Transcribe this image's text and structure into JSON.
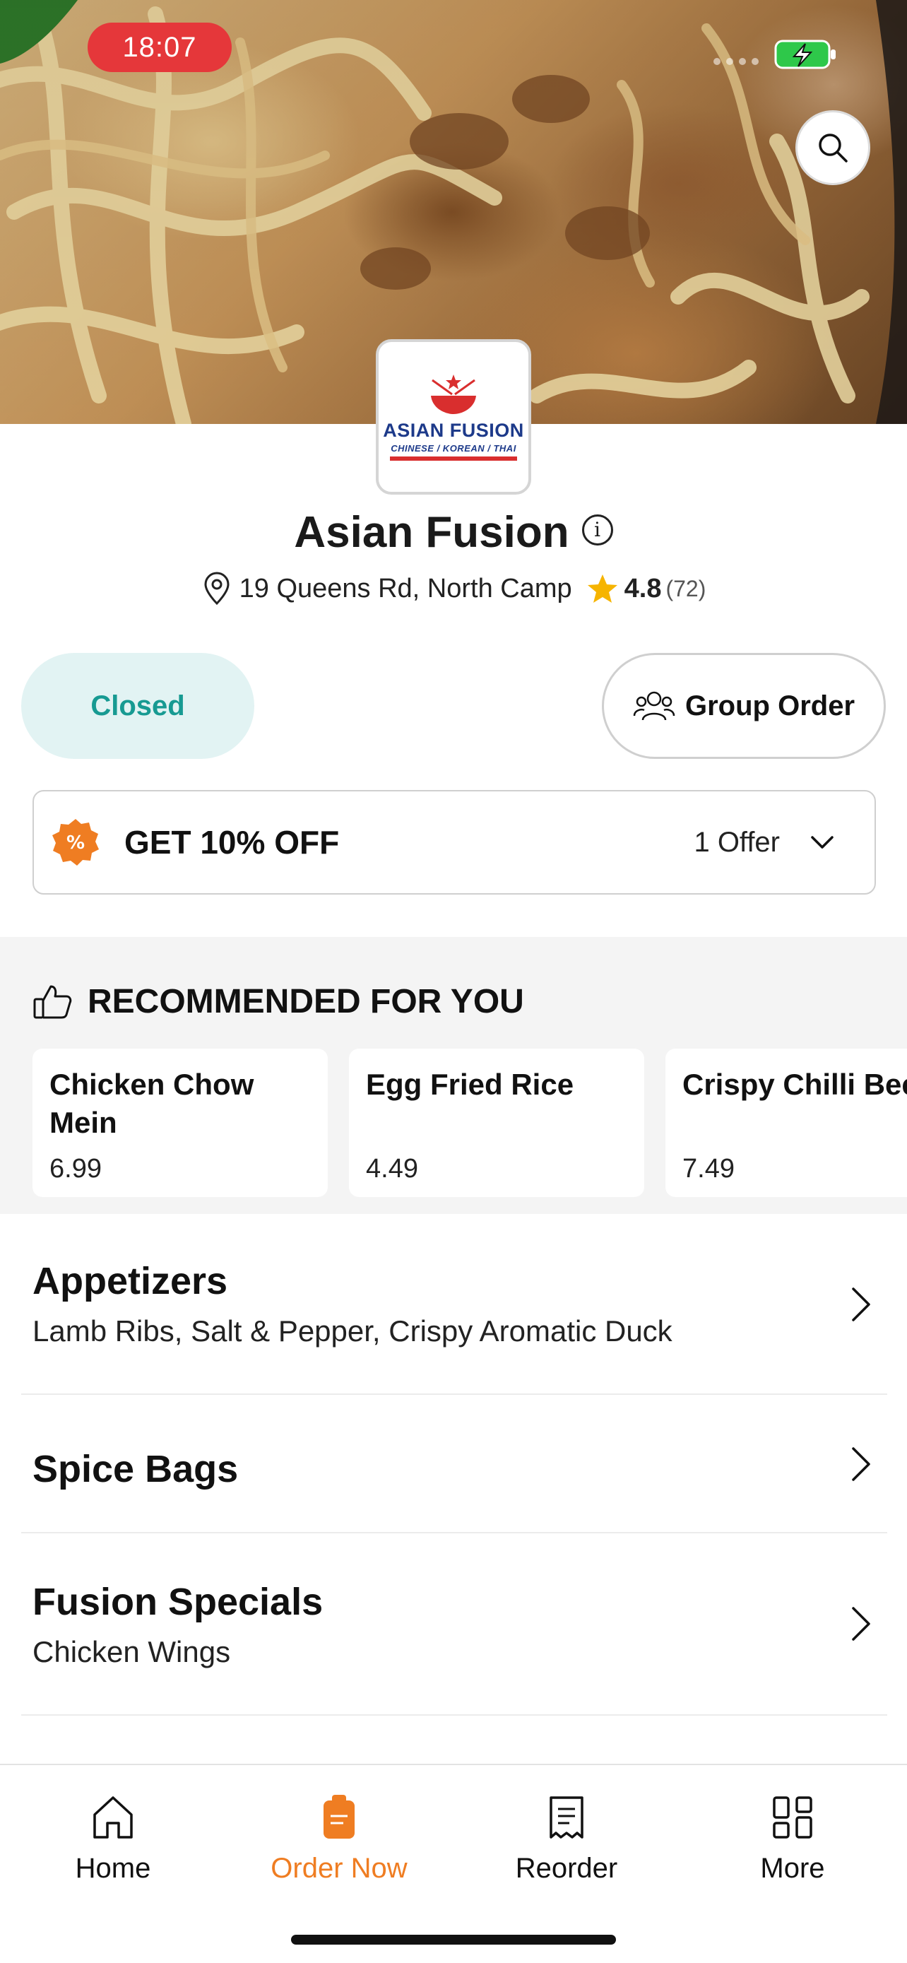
{
  "status": {
    "time": "18:07"
  },
  "restaurant": {
    "name": "Asian Fusion",
    "logo_name": "ASIAN FUSION",
    "logo_sub": "CHINESE / KOREAN / THAI",
    "address": "19 Queens Rd, North Camp",
    "rating": "4.8",
    "rating_count": "(72)"
  },
  "status_pill": "Closed",
  "group_order_label": "Group Order",
  "offer": {
    "label": "GET 10% OFF",
    "count": "1 Offer"
  },
  "recommended": {
    "title": "RECOMMENDED FOR YOU",
    "items": [
      {
        "name": "Chicken Chow Mein",
        "price": "6.99"
      },
      {
        "name": "Egg Fried Rice",
        "price": "4.49"
      },
      {
        "name": "Crispy Chilli Beef",
        "price": "7.49"
      }
    ]
  },
  "categories": [
    {
      "title": "Appetizers",
      "subtitle": "Lamb Ribs, Salt & Pepper, Crispy Aromatic Duck"
    },
    {
      "title": "Spice Bags",
      "subtitle": ""
    },
    {
      "title": "Fusion Specials",
      "subtitle": "Chicken Wings"
    }
  ],
  "tabs": [
    {
      "label": "Home",
      "icon": "home-icon",
      "active": false
    },
    {
      "label": "Order Now",
      "icon": "order-icon",
      "active": true
    },
    {
      "label": "Reorder",
      "icon": "receipt-icon",
      "active": false
    },
    {
      "label": "More",
      "icon": "grid-icon",
      "active": false
    }
  ],
  "colors": {
    "accent": "#ef7d22",
    "closed_bg": "#e2f3f3",
    "closed_text": "#179a92",
    "status_red": "#e5373a"
  }
}
